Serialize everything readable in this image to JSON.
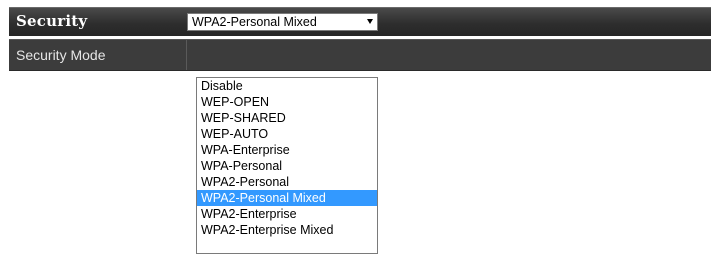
{
  "section": {
    "title": "Security"
  },
  "security_mode": {
    "label": "Security Mode",
    "selected_value": "WPA2-Personal Mixed",
    "options": [
      {
        "label": "Disable",
        "selected": false
      },
      {
        "label": "WEP-OPEN",
        "selected": false
      },
      {
        "label": "WEP-SHARED",
        "selected": false
      },
      {
        "label": "WEP-AUTO",
        "selected": false
      },
      {
        "label": "WPA-Enterprise",
        "selected": false
      },
      {
        "label": "WPA-Personal",
        "selected": false
      },
      {
        "label": "WPA2-Personal",
        "selected": false
      },
      {
        "label": "WPA2-Personal Mixed",
        "selected": true
      },
      {
        "label": "WPA2-Enterprise",
        "selected": false
      },
      {
        "label": "WPA2-Enterprise Mixed",
        "selected": false
      }
    ],
    "arrow_icon": "triangle-down-icon"
  },
  "colors": {
    "header_bg": "#2e2e2e",
    "row_bg": "#3c3c3c",
    "highlight": "#3399ff"
  }
}
